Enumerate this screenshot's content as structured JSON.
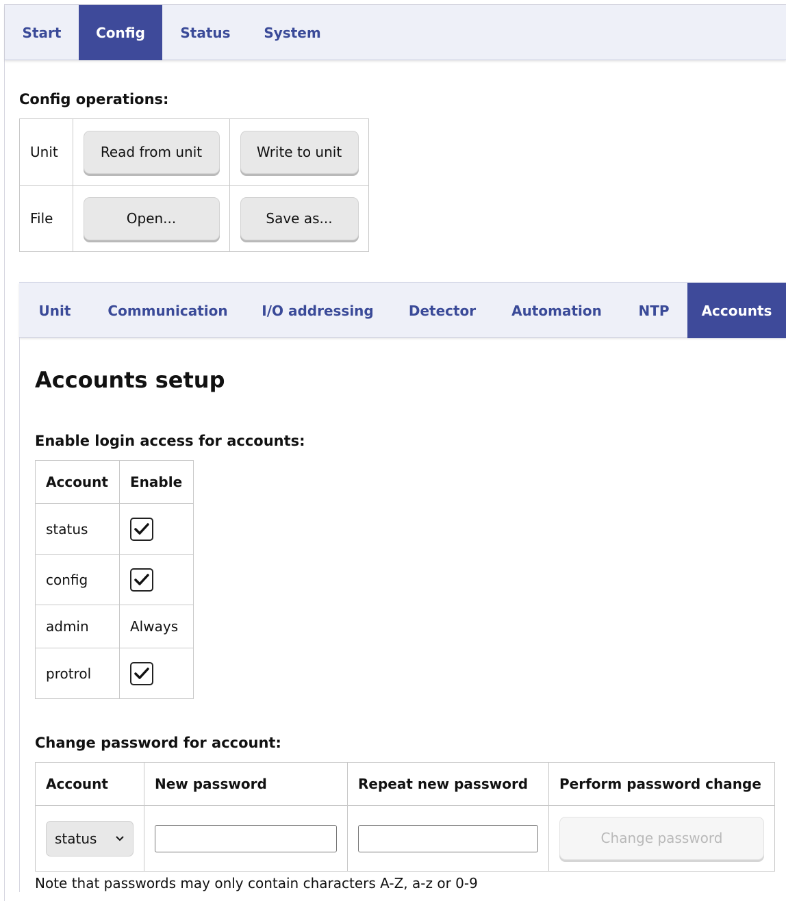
{
  "top_nav": {
    "tabs": [
      {
        "label": "Start"
      },
      {
        "label": "Config"
      },
      {
        "label": "Status"
      },
      {
        "label": "System"
      }
    ],
    "active": "Config"
  },
  "config_ops": {
    "title": "Config operations:",
    "rows": [
      {
        "label": "Unit",
        "buttons": [
          "Read from unit",
          "Write to unit"
        ]
      },
      {
        "label": "File",
        "buttons": [
          "Open...",
          "Save as..."
        ]
      }
    ]
  },
  "sub_nav": {
    "tabs": [
      {
        "label": "Unit"
      },
      {
        "label": "Communication"
      },
      {
        "label": "I/O addressing"
      },
      {
        "label": "Detector"
      },
      {
        "label": "Automation"
      },
      {
        "label": "NTP"
      },
      {
        "label": "Accounts"
      }
    ],
    "active": "Accounts"
  },
  "accounts": {
    "heading": "Accounts setup",
    "enable_section": {
      "title": "Enable login access for accounts:",
      "headers": [
        "Account",
        "Enable"
      ],
      "rows": [
        {
          "account": "status",
          "enable": "checked"
        },
        {
          "account": "config",
          "enable": "checked"
        },
        {
          "account": "admin",
          "enable": "Always"
        },
        {
          "account": "protrol",
          "enable": "checked"
        }
      ]
    },
    "password_section": {
      "title": "Change password for account:",
      "headers": [
        "Account",
        "New password",
        "Repeat new password",
        "Perform password change"
      ],
      "selected_account": "status",
      "new_password": "",
      "repeat_password": "",
      "button_label": "Change password"
    },
    "note": "Note that passwords may only contain characters A-Z, a-z or 0-9"
  }
}
